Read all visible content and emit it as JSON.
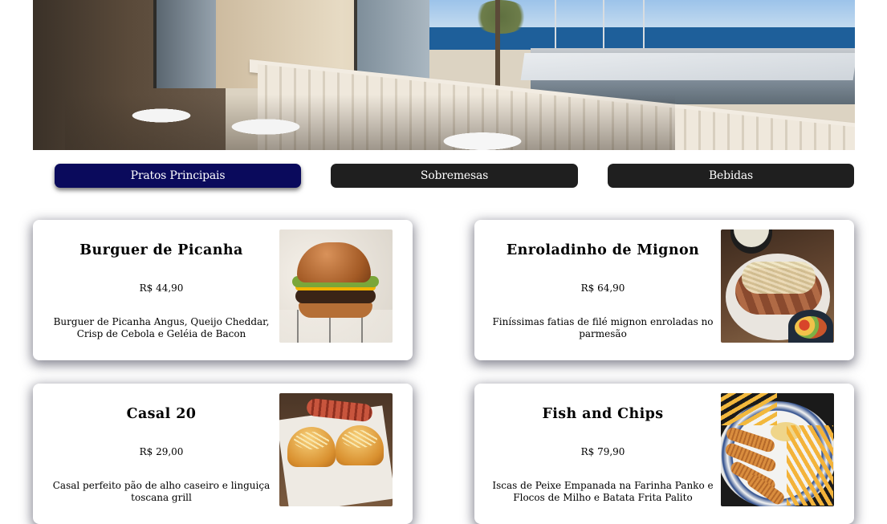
{
  "tabs": [
    {
      "label": "Pratos Principais",
      "active": true
    },
    {
      "label": "Sobremesas",
      "active": false
    },
    {
      "label": "Bebidas",
      "active": false
    }
  ],
  "items": [
    {
      "name": "Burguer de Picanha",
      "price": "R$ 44,90",
      "description": "Burguer de Picanha Angus, Queijo Cheddar, Crisp de Cebola e Geléia de Bacon"
    },
    {
      "name": "Enroladinho de Mignon",
      "price": "R$ 64,90",
      "description": "Finíssimas fatias de filé mignon enroladas no parmesão"
    },
    {
      "name": "Casal 20",
      "price": "R$ 29,00",
      "description": "Casal perfeito pão de alho caseiro e linguiça toscana grill"
    },
    {
      "name": "Fish and Chips",
      "price": "R$ 79,90",
      "description": "Iscas de Peixe Empanada na Farinha Panko e Flocos de Milho e Batata Frita Palito"
    }
  ],
  "colors": {
    "active_tab": "#0a0a5c",
    "tab": "#1f1f1f",
    "tab_text": "#ffffff"
  }
}
